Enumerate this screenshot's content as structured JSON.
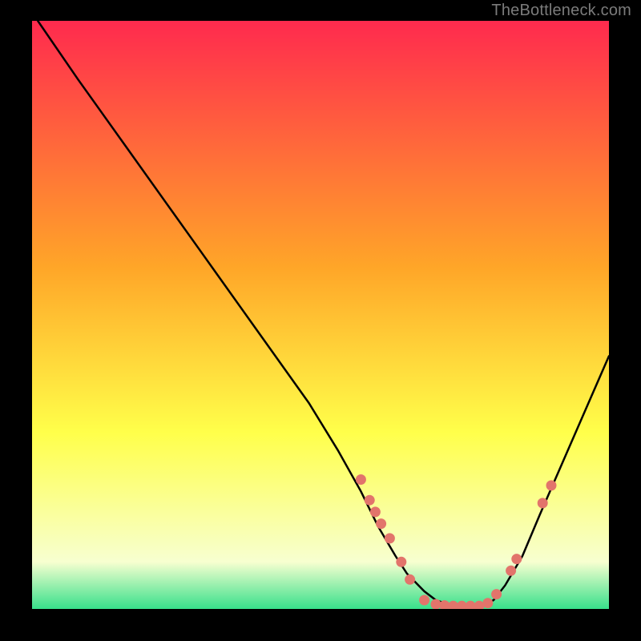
{
  "attribution": "TheBottleneck.com",
  "colors": {
    "gradient_top": "#ff2a4e",
    "gradient_mid1": "#ffa628",
    "gradient_mid2": "#ffff4a",
    "gradient_pale": "#f7ffd0",
    "gradient_bottom": "#38e08b",
    "line": "#000000",
    "marker": "#e2746b",
    "background": "#000000"
  },
  "chart_data": {
    "type": "line",
    "title": "",
    "xlabel": "",
    "ylabel": "",
    "xlim": [
      0,
      100
    ],
    "ylim": [
      0,
      100
    ],
    "series": [
      {
        "name": "curve",
        "x": [
          1,
          8,
          16,
          24,
          32,
          40,
          48,
          53,
          57,
          60,
          63,
          65,
          68,
          70,
          73,
          75,
          78,
          80,
          82,
          85,
          88,
          92,
          96,
          100
        ],
        "y": [
          100,
          90,
          79,
          68,
          57,
          46,
          35,
          27,
          20,
          14,
          9,
          6,
          3,
          1.5,
          0.5,
          0.2,
          0.5,
          1.5,
          4,
          9,
          16,
          25,
          34,
          43
        ]
      }
    ],
    "markers": [
      {
        "x": 57.0,
        "y": 22.0
      },
      {
        "x": 58.5,
        "y": 18.5
      },
      {
        "x": 59.5,
        "y": 16.5
      },
      {
        "x": 60.5,
        "y": 14.5
      },
      {
        "x": 62.0,
        "y": 12.0
      },
      {
        "x": 64.0,
        "y": 8.0
      },
      {
        "x": 65.5,
        "y": 5.0
      },
      {
        "x": 68.0,
        "y": 1.5
      },
      {
        "x": 70.0,
        "y": 0.8
      },
      {
        "x": 71.5,
        "y": 0.6
      },
      {
        "x": 73.0,
        "y": 0.5
      },
      {
        "x": 74.5,
        "y": 0.5
      },
      {
        "x": 76.0,
        "y": 0.5
      },
      {
        "x": 77.5,
        "y": 0.5
      },
      {
        "x": 79.0,
        "y": 1.0
      },
      {
        "x": 80.5,
        "y": 2.5
      },
      {
        "x": 83.0,
        "y": 6.5
      },
      {
        "x": 84.0,
        "y": 8.5
      },
      {
        "x": 88.5,
        "y": 18.0
      },
      {
        "x": 90.0,
        "y": 21.0
      }
    ]
  }
}
